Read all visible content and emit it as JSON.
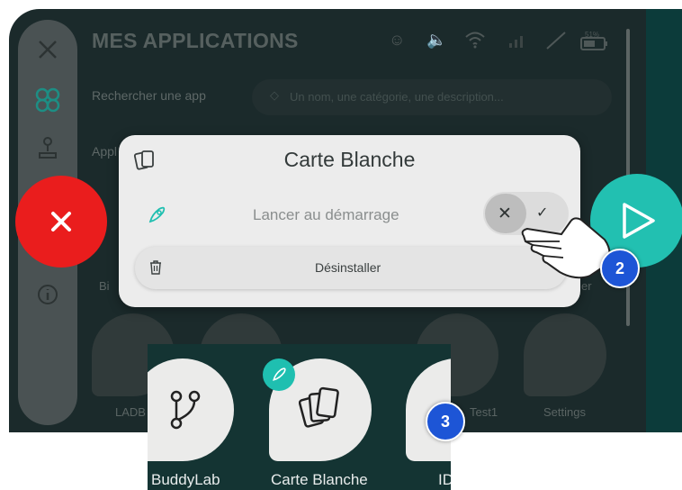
{
  "screen": {
    "title": "MES APPLICATIONS",
    "search_label": "Rechercher une app",
    "search_placeholder": "Un nom, une catégorie, une description...",
    "apps_label": "Appl",
    "battery_text": "51%",
    "bg_labels": {
      "left_row1": "Bi",
      "right_row1": "er",
      "ladb": "LADB",
      "test1": "Test1",
      "settings": "Settings"
    }
  },
  "sidebar": {
    "items": [
      {
        "icon": "close-icon"
      },
      {
        "icon": "apps-icon"
      },
      {
        "icon": "joystick-icon"
      },
      {
        "icon": "info-icon"
      }
    ]
  },
  "modal": {
    "title": "Carte Blanche",
    "launch_label": "Lancer au démarrage",
    "toggle_off": "✕",
    "toggle_on": "✓",
    "uninstall_label": "Désinstaller"
  },
  "badges": {
    "step2": "2",
    "step3": "3"
  },
  "inset": {
    "apps": [
      {
        "label": "BuddyLab",
        "icon": "branch-icon"
      },
      {
        "label": "Carte Blanche",
        "icon": "cards-icon"
      },
      {
        "label": "ID",
        "icon": "app-icon"
      }
    ]
  },
  "colors": {
    "close": "#ea1d1d",
    "play": "#22c0b1",
    "badge": "#1d55d6",
    "screen_bg": "#1b2a2b",
    "accent": "#1d8e84"
  }
}
